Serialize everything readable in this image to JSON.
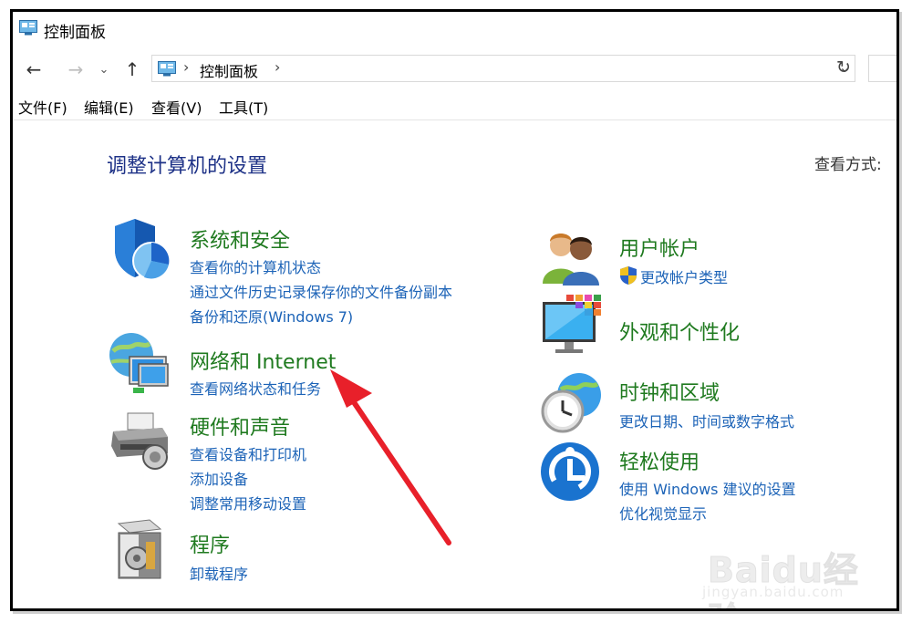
{
  "window": {
    "title": "控制面板"
  },
  "address_bar": {
    "crumb": "控制面板"
  },
  "menu": [
    "文件(F)",
    "编辑(E)",
    "查看(V)",
    "工具(T)"
  ],
  "content": {
    "heading": "调整计算机的设置",
    "view_by": "查看方式:"
  },
  "categories_left": [
    {
      "title": "系统和安全",
      "icon": "shield-icon",
      "links": [
        "查看你的计算机状态",
        "通过文件历史记录保存你的文件备份副本",
        "备份和还原(Windows 7)"
      ]
    },
    {
      "title": "网络和 Internet",
      "icon": "network-icon",
      "links": [
        "查看网络状态和任务"
      ]
    },
    {
      "title": "硬件和声音",
      "icon": "printer-icon",
      "links": [
        "查看设备和打印机",
        "添加设备",
        "调整常用移动设置"
      ]
    },
    {
      "title": "程序",
      "icon": "programs-icon",
      "links": [
        "卸载程序"
      ]
    }
  ],
  "categories_right": [
    {
      "title": "用户帐户",
      "icon": "users-icon",
      "links": [
        "更改帐户类型"
      ]
    },
    {
      "title": "外观和个性化",
      "icon": "monitor-icon",
      "links": []
    },
    {
      "title": "时钟和区域",
      "icon": "clock-icon",
      "links": [
        "更改日期、时间或数字格式"
      ]
    },
    {
      "title": "轻松使用",
      "icon": "ease-of-access-icon",
      "links": [
        "使用 Windows 建议的设置",
        "优化视觉显示"
      ]
    }
  ],
  "watermark": {
    "brand": "Baidu经验",
    "url": "jingyan.baidu.com"
  },
  "colors": {
    "category_title": "#1f7a1f",
    "link": "#1c63b7",
    "heading": "#1e3287",
    "arrow": "#e8202a"
  }
}
